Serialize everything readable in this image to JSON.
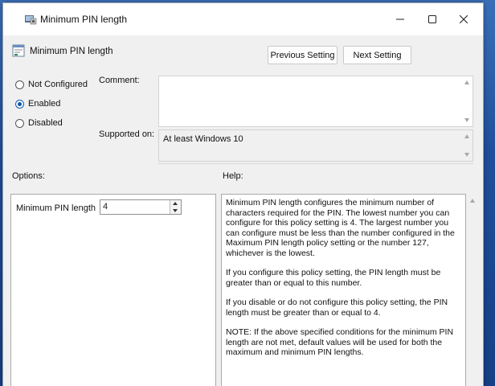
{
  "window": {
    "title": "Minimum PIN length",
    "controls": {
      "minimize": "minimize-icon",
      "maximize": "maximize-icon",
      "close": "close-icon"
    }
  },
  "header": {
    "title": "Minimum PIN length",
    "previous_label": "Previous Setting",
    "next_label": "Next Setting"
  },
  "state": {
    "options": [
      {
        "label": "Not Configured",
        "checked": false
      },
      {
        "label": "Enabled",
        "checked": true
      },
      {
        "label": "Disabled",
        "checked": false
      }
    ]
  },
  "comment": {
    "label": "Comment:",
    "value": ""
  },
  "supported": {
    "label": "Supported on:",
    "value": "At least Windows 10"
  },
  "options_section": {
    "label": "Options:",
    "field_label": "Minimum PIN length",
    "field_value": "4"
  },
  "help_section": {
    "label": "Help:",
    "paragraphs": [
      "Minimum PIN length configures the minimum number of characters required for the PIN.  The lowest number you can configure for this policy setting is 4.  The largest number you can configure must be less than the number configured in the Maximum PIN length policy setting or the number 127, whichever is the lowest.",
      "If you configure this policy setting, the PIN length must be greater than or equal to this number.",
      "If you disable or do not configure this policy setting, the PIN length must be greater than or equal to 4.",
      "NOTE: If the above specified conditions for the minimum PIN length are not met, default values will be used for both the maximum and minimum PIN lengths."
    ]
  },
  "colors": {
    "accent": "#0b57a8",
    "window_bg": "#f0f0f0",
    "desktop": "#1f4f9c"
  }
}
